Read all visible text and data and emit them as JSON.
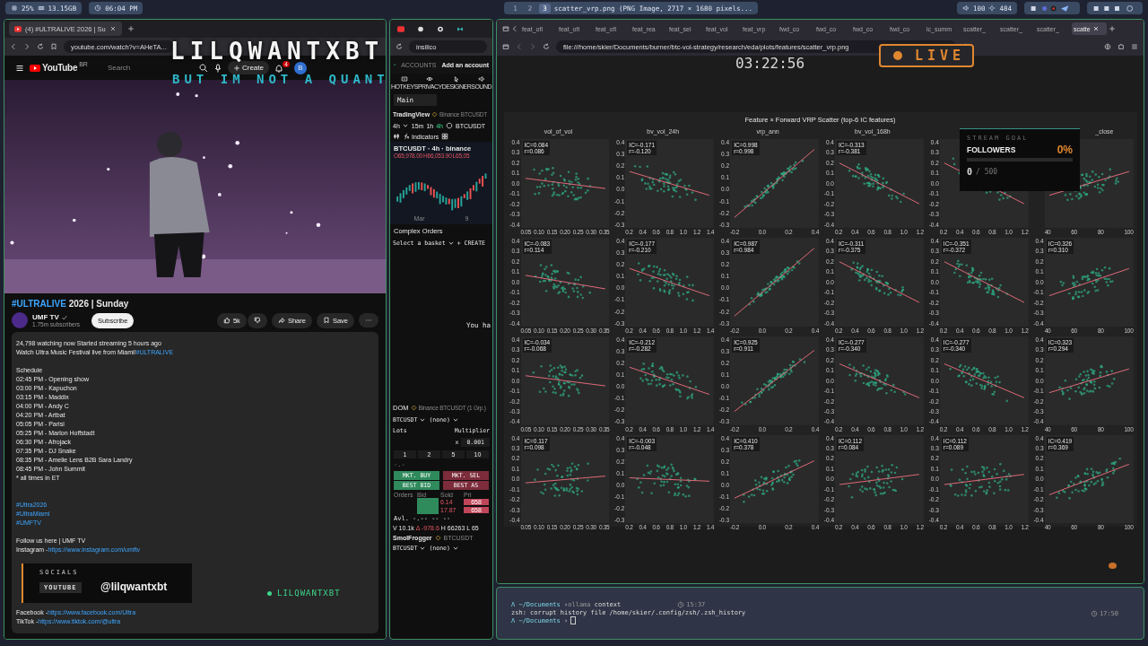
{
  "top_bar": {
    "cpu": "25%",
    "memory": "13.15GB",
    "clock": "06:04 PM",
    "workspaces": [
      {
        "label": "1",
        "selected": false
      },
      {
        "label": "2",
        "selected": false
      },
      {
        "label": "3",
        "selected": true
      }
    ],
    "window_title": "scatter_vrp.png (PNG Image, 2717 × 1680 pixels...",
    "volume": "100",
    "brightness": "484"
  },
  "youtube": {
    "tab_title": "(4) #ULTRALIVE 2026 | Su",
    "url": "youtube.com/watch?v=AHeTA...",
    "logo": "YouTube",
    "region": "BR",
    "search_placeholder": "Search",
    "create": "Create",
    "notifications": "4",
    "avatar": "B",
    "title_tag": "#ULTRALIVE",
    "title_rest": "2026 | Sunday",
    "channel": "UMF TV",
    "subscribers": "1.75m subscribers",
    "subscribe": "Subscribe",
    "likes": "5k",
    "share": "Share",
    "save": "Save",
    "description": [
      {
        "kind": "text",
        "text": "24,798 watching now Started streaming 5 hours ago"
      },
      {
        "kind": "text",
        "text": "Watch Ultra Music Festival live from Miami!",
        "link": "#ULTRALIVE"
      },
      {
        "kind": "gap"
      },
      {
        "kind": "text",
        "text": "Schedule"
      },
      {
        "kind": "text",
        "text": "02:45 PM - Opening show"
      },
      {
        "kind": "text",
        "text": "03:00 PM - Kapuchon"
      },
      {
        "kind": "text",
        "text": "03:15 PM - Maddix"
      },
      {
        "kind": "text",
        "text": "04:00 PM - Andy C"
      },
      {
        "kind": "text",
        "text": "04:20 PM - Artbat"
      },
      {
        "kind": "text",
        "text": "05:05 PM - Parisi"
      },
      {
        "kind": "text",
        "text": "05:25 PM - Marlon Hoffstadt"
      },
      {
        "kind": "text",
        "text": "06:30 PM - Afrojack"
      },
      {
        "kind": "text",
        "text": "07:35 PM - DJ Snake"
      },
      {
        "kind": "text",
        "text": "08:35 PM - Amelie Lens B2B Sara Landry"
      },
      {
        "kind": "text",
        "text": "08:45 PM - John Summit"
      },
      {
        "kind": "text",
        "text": "* all times in ET"
      },
      {
        "kind": "gap"
      },
      {
        "kind": "gap"
      },
      {
        "kind": "text",
        "link": "#Ultra2026"
      },
      {
        "kind": "text",
        "link": "#UltraMiami"
      },
      {
        "kind": "text",
        "link": "#UMFTV"
      },
      {
        "kind": "gap"
      },
      {
        "kind": "text",
        "text": "Follow us here | UMF TV"
      },
      {
        "kind": "text",
        "text": "Instagram -",
        "link": "https://www.instagram.com/umftv"
      },
      {
        "kind": "gap"
      },
      {
        "kind": "gap"
      },
      {
        "kind": "gap"
      },
      {
        "kind": "gap"
      },
      {
        "kind": "gap"
      },
      {
        "kind": "gap"
      },
      {
        "kind": "text",
        "text": "Facebook -",
        "link": "https://www.facebook.com/Ultra"
      },
      {
        "kind": "text",
        "text": "TikTok -",
        "link": "https://www.tiktok.com/@ultra"
      }
    ]
  },
  "trading": {
    "url": "insilico",
    "accounts": "ACCOUNTS",
    "add_account": "Add an account",
    "tools": [
      "HOTKEYS",
      "PRIVACY",
      "DESIGNER",
      "SOUND"
    ],
    "main_tab": "Main",
    "widget": "TradingView",
    "widget_symbol": "Binance BTCUSDT",
    "interval": "4h",
    "intervals": [
      {
        "label": "15m",
        "selected": false
      },
      {
        "label": "1h",
        "selected": false
      },
      {
        "label": "4h",
        "selected": true
      }
    ],
    "symbol": "BTCUSDT",
    "indicators": "Indicators",
    "chart_title": "BTCUSDT · 4h · binance",
    "open": "O65,978.00",
    "high": "H66,053.90",
    "low": "L65,05",
    "x_label": "Mar",
    "x_label_2": "9",
    "complex_orders": "Complex Orders",
    "basket_placeholder": "Select a basket",
    "create": "+ CREATE",
    "empty_note": "You ha",
    "dom": "DOM",
    "dom_source": "Binance BTCUSDT (1 Grp.)",
    "dom_symbol": "BTCUSDT",
    "dom_group": "(none)",
    "lots": "Lots",
    "multiplier": "Multiplier",
    "multiplier_x": "x",
    "multiplier_value": "0.001",
    "lot_sizes": [
      "1",
      "2",
      "5",
      "10"
    ],
    "dash": "-.-",
    "buy_buttons": [
      "MKT. BUY",
      "BEST BID"
    ],
    "sell_buttons": [
      "MKT. SEL",
      "BEST AS"
    ],
    "book_columns": [
      "Orders",
      "Bid",
      "Sold",
      "Pri"
    ],
    "book_rows": [
      {
        "sold": "6.14",
        "price": "658"
      },
      {
        "sold": "17.87",
        "price": "658"
      }
    ],
    "avl": "Avl. -.-- -- --",
    "volume": "V 10.1k",
    "delta": "Δ -978.6",
    "high2": "H 66263",
    "low2": "L 65",
    "account": "SmolFrogger",
    "account_symbol": "BTCUSDT",
    "bottom_symbol": "BTCUSDT",
    "bottom_group": "(none)"
  },
  "firefox": {
    "tabs": [
      {
        "label": "feat_ofi",
        "selected": false
      },
      {
        "label": "feat_ofi",
        "selected": false
      },
      {
        "label": "feat_ofi",
        "selected": false
      },
      {
        "label": "feat_rea",
        "selected": false
      },
      {
        "label": "feat_sei",
        "selected": false
      },
      {
        "label": "feat_vol",
        "selected": false
      },
      {
        "label": "feat_vrp",
        "selected": false
      },
      {
        "label": "fwd_co",
        "selected": false
      },
      {
        "label": "fwd_co",
        "selected": false
      },
      {
        "label": "fwd_co",
        "selected": false
      },
      {
        "label": "fwd_co",
        "selected": false
      },
      {
        "label": "ic_summ",
        "selected": false
      },
      {
        "label": "scatter_",
        "selected": false
      },
      {
        "label": "scatter_",
        "selected": false
      },
      {
        "label": "scatter_",
        "selected": false
      },
      {
        "label": "scatte",
        "selected": true
      }
    ],
    "url": "file:///home/skier/Documents/burner/btc-vol-strategy/research/eda/plots/features/scatter_vrp.png",
    "plot": {
      "title": "Feature × Forward VRP Scatter (top-6 IC features)",
      "columns": [
        {
          "title": "vol_of_vol"
        },
        {
          "title": "bv_vol_24h"
        },
        {
          "title": "vrp_ann"
        },
        {
          "title": "bv_vol_168h"
        },
        {},
        {
          "title": "_close"
        }
      ],
      "rows": [
        {
          "panels": [
            {
              "ic": "IC=0.084",
              "r": "r=0.086",
              "xticks": [
                "0.05",
                "0.10",
                "0.15",
                "0.20",
                "0.25",
                "0.30",
                "0.35"
              ],
              "yticks": [
                "0.4",
                "0.3",
                "0.2",
                "0.1",
                "0.0",
                "-0.1",
                "-0.2",
                "-0.3",
                "-0.4"
              ]
            },
            {
              "ic": "IC=-0.171",
              "r": "r=-0.120",
              "xticks": [
                "0.2",
                "0.4",
                "0.6",
                "0.8",
                "1.0",
                "1.2",
                "1.4"
              ],
              "yticks": [
                "0.4",
                "0.3",
                "0.2",
                "0.1",
                "0.0",
                "-0.1",
                "-0.2",
                "-0.3"
              ]
            },
            {
              "ic": "IC=0.998",
              "r": "r=0.998",
              "xticks": [
                "-0.2",
                "0.0",
                "0.2",
                "0.4"
              ],
              "yticks": [
                "0.4",
                "0.3",
                "0.2",
                "0.1",
                "0.0",
                "-0.1",
                "-0.2",
                "-0.3"
              ]
            },
            {
              "ic": "IC=-0.313",
              "r": "r=-0.381",
              "xticks": [
                "0.2",
                "0.4",
                "0.6",
                "0.8",
                "1.0",
                "1.2"
              ],
              "yticks": [
                "0.4",
                "0.3",
                "0.2",
                "0.1",
                "0.0",
                "-0.1",
                "-0.2",
                "-0.3",
                "-0.4"
              ]
            },
            {
              "xticks": [
                "0.2",
                "0.4",
                "0.6",
                "0.8",
                "1.0",
                "1.2"
              ],
              "yticks": [
                "0.4",
                "0.3",
                "0.2",
                "0.1",
                "0.0",
                "-0.1",
                "-0.2",
                "-0.3",
                "-0.4"
              ]
            },
            {
              "xticks": [
                "40",
                "60",
                "80",
                "100"
              ]
            }
          ]
        },
        {
          "panels": [
            {
              "ic": "IC=-0.083",
              "r": "r=0.114",
              "xticks": [
                "0.05",
                "0.10",
                "0.15",
                "0.20",
                "0.25",
                "0.30",
                "0.35"
              ],
              "yticks": [
                "0.4",
                "0.3",
                "0.2",
                "0.1",
                "0.0",
                "-0.1",
                "-0.2",
                "-0.3",
                "-0.4"
              ]
            },
            {
              "ic": "IC=-0.177",
              "r": "r=-0.210",
              "xticks": [
                "0.2",
                "0.4",
                "0.6",
                "0.8",
                "1.0",
                "1.2",
                "1.4"
              ],
              "yticks": [
                "0.4",
                "0.3",
                "0.2",
                "0.1",
                "0.0",
                "-0.1",
                "-0.2",
                "-0.3"
              ]
            },
            {
              "ic": "IC=0.987",
              "r": "r=0.984",
              "xticks": [
                "-0.2",
                "0.0",
                "0.2",
                "0.4"
              ],
              "yticks": [
                "0.4",
                "0.3",
                "0.2",
                "0.1",
                "0.0",
                "-0.1",
                "-0.2",
                "-0.3"
              ]
            },
            {
              "ic": "IC=-0.311",
              "r": "r=-0.375",
              "xticks": [
                "0.2",
                "0.4",
                "0.6",
                "0.8",
                "1.0",
                "1.2"
              ],
              "yticks": [
                "0.4",
                "0.3",
                "0.2",
                "0.1",
                "0.0",
                "-0.1",
                "-0.2",
                "-0.3",
                "-0.4"
              ]
            },
            {
              "ic": "IC=-0.351",
              "r": "r=-0.372",
              "xticks": [
                "0.2",
                "0.4",
                "0.6",
                "0.8",
                "1.0",
                "1.2"
              ],
              "yticks": [
                "0.4",
                "0.3",
                "0.2",
                "0.1",
                "0.0",
                "-0.1",
                "-0.2",
                "-0.3",
                "-0.4"
              ]
            },
            {
              "ic": "IC=0.326",
              "r": "r=0.310",
              "xticks": [
                "40",
                "60",
                "80",
                "100"
              ],
              "yticks": [
                "0.4",
                "0.3",
                "0.2",
                "0.1",
                "0.0",
                "-0.1",
                "-0.2",
                "-0.3",
                "-0.4"
              ]
            }
          ]
        },
        {
          "panels": [
            {
              "ic": "IC=-0.034",
              "r": "r=-0.068",
              "xticks": [
                "0.05",
                "0.10",
                "0.15",
                "0.20",
                "0.25",
                "0.30",
                "0.35"
              ],
              "yticks": [
                "0.4",
                "0.3",
                "0.2",
                "0.1",
                "0.0",
                "-0.1",
                "-0.2",
                "-0.3",
                "-0.4"
              ]
            },
            {
              "ic": "IC=-0.212",
              "r": "r=-0.282",
              "xticks": [
                "0.2",
                "0.4",
                "0.6",
                "0.8",
                "1.0",
                "1.2",
                "1.4"
              ],
              "yticks": [
                "0.4",
                "0.3",
                "0.2",
                "0.1",
                "0.0",
                "-0.1",
                "-0.2",
                "-0.3"
              ]
            },
            {
              "ic": "IC=0.925",
              "r": "r=0.911",
              "xticks": [
                "-0.2",
                "0.0",
                "0.2",
                "0.4"
              ],
              "yticks": [
                "0.4",
                "0.3",
                "0.2",
                "0.1",
                "0.0",
                "-0.1",
                "-0.2",
                "-0.3"
              ]
            },
            {
              "ic": "IC=-0.277",
              "r": "r=-0.340",
              "xticks": [
                "0.2",
                "0.4",
                "0.6",
                "0.8",
                "1.0",
                "1.2"
              ],
              "yticks": [
                "0.4",
                "0.3",
                "0.2",
                "0.1",
                "0.0",
                "-0.1",
                "-0.2",
                "-0.3",
                "-0.4"
              ]
            },
            {
              "ic": "IC=-0.277",
              "r": "r=-0.340",
              "xticks": [
                "0.2",
                "0.4",
                "0.6",
                "0.8",
                "1.0",
                "1.2"
              ],
              "yticks": [
                "0.4",
                "0.3",
                "0.2",
                "0.1",
                "0.0",
                "-0.1",
                "-0.2",
                "-0.3",
                "-0.4"
              ]
            },
            {
              "ic": "IC=0.323",
              "r": "r=0.294",
              "xticks": [
                "40",
                "60",
                "80",
                "100"
              ],
              "yticks": [
                "0.4",
                "0.3",
                "0.2",
                "0.1",
                "0.0",
                "-0.1",
                "-0.2",
                "-0.3",
                "-0.4"
              ]
            }
          ]
        },
        {
          "panels": [
            {
              "ic": "IC=0.117",
              "r": "r=0.098",
              "xticks": [
                "0.05",
                "0.10",
                "0.15",
                "0.20",
                "0.25",
                "0.30",
                "0.35"
              ],
              "yticks": [
                "0.4",
                "0.3",
                "0.2",
                "0.1",
                "0.0",
                "-0.1",
                "-0.2",
                "-0.3",
                "-0.4"
              ]
            },
            {
              "ic": "IC=-0.003",
              "r": "r=-0.048",
              "xticks": [
                "0.2",
                "0.4",
                "0.6",
                "0.8",
                "1.0",
                "1.2",
                "1.4"
              ],
              "yticks": [
                "0.4",
                "0.3",
                "0.2",
                "0.1",
                "0.0",
                "-0.1",
                "-0.2",
                "-0.3"
              ]
            },
            {
              "ic": "IC=0.410",
              "r": "r=0.378",
              "xticks": [
                "-0.2",
                "0.0",
                "0.2",
                "0.4"
              ],
              "yticks": [
                "0.4",
                "0.3",
                "0.2",
                "0.1",
                "0.0",
                "-0.1",
                "-0.2",
                "-0.3"
              ]
            },
            {
              "ic": "IC=0.112",
              "r": "r=0.084",
              "xticks": [
                "0.2",
                "0.4",
                "0.6",
                "0.8",
                "1.0",
                "1.2"
              ],
              "yticks": [
                "0.4",
                "0.3",
                "0.2",
                "0.1",
                "0.0",
                "-0.1",
                "-0.2",
                "-0.3",
                "-0.4"
              ]
            },
            {
              "ic": "IC=0.112",
              "r": "r=0.089",
              "xticks": [
                "0.2",
                "0.4",
                "0.6",
                "0.8",
                "1.0",
                "1.2"
              ],
              "yticks": [
                "0.4",
                "0.3",
                "0.2",
                "0.1",
                "0.0",
                "-0.1",
                "-0.2",
                "-0.3",
                "-0.4"
              ]
            },
            {
              "ic": "IC=0.419",
              "r": "r=0.369",
              "xticks": [
                "40",
                "60",
                "80",
                "100"
              ],
              "yticks": [
                "0.4",
                "0.3",
                "0.2",
                "0.1",
                "0.0",
                "-0.1",
                "-0.2",
                "-0.3",
                "-0.4"
              ]
            }
          ]
        }
      ]
    }
  },
  "terminal": {
    "lines": [
      {
        "mark": "Λ",
        "prompt": "~/Documents",
        "arrow": "›",
        "command": "ollama",
        "args": "context",
        "time": "15:37"
      },
      {
        "output": "zsh: corrupt history file /home/skier/.config/zsh/.zsh_history"
      },
      {
        "mark": "Λ",
        "prompt": "~/Documents",
        "arrow": "›",
        "cursor": true
      }
    ],
    "right_time": "17:50"
  },
  "overlay": {
    "brand": "LILQWANTXBT",
    "tagline": "BUT IM NOT A QUANT",
    "timer": "03:22:56",
    "live": "LIVE",
    "goal": {
      "label": "STREAM GOAL",
      "title": "FOLLOWERS",
      "percent": "0%",
      "level": 0,
      "count": "0",
      "target": "/ 500"
    },
    "socials": {
      "label": "SOCIALS",
      "platform": "YOUTUBE",
      "handle": "@lilqwantxbt"
    },
    "ticker": "LILQWANTXBT"
  }
}
